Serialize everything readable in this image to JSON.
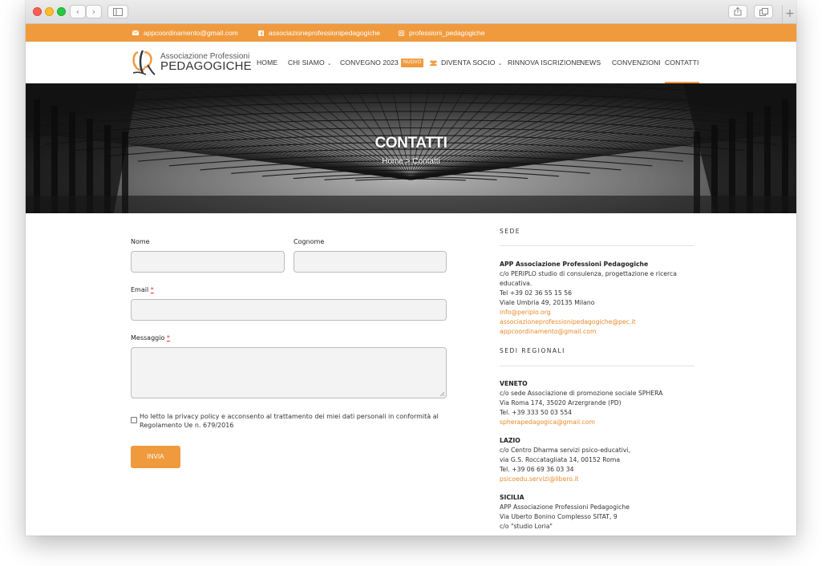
{
  "browser": {
    "back": "‹",
    "forward": "›",
    "new_tab": "+"
  },
  "topbar": {
    "email": "appcoordinamento@gmail.com",
    "facebook": "associazioneprofessionipedagogiche",
    "instagram": "professioni_pedagogiche"
  },
  "logo": {
    "line1": "Associazione Professioni",
    "line2": "PEDAGOGICHE"
  },
  "nav": {
    "home": "HOME",
    "chi_siamo": "CHI SIAMO",
    "convegno": "CONVEGNO 2023",
    "convegno_badge": "NUOVO",
    "diventa_socio": "DIVENTA SOCIO",
    "rinnova": "RINNOVA ISCRIZIONE",
    "news": "NEWS",
    "convenzioni": "CONVENZIONI",
    "contatti": "CONTATTI"
  },
  "hero": {
    "title": "CONTATTI",
    "breadcrumb": "Home > Contatti"
  },
  "form": {
    "nome_label": "Nome",
    "cognome_label": "Cognome",
    "email_label": "Email",
    "messaggio_label": "Messaggio",
    "required_mark": "*",
    "privacy_text": "Ho letto la privacy policy e acconsento al trattamento dei miei dati personali in conformità al Regolamento Ue n. 679/2016",
    "submit_label": "INVIA"
  },
  "sidebar": {
    "sede_heading": "SEDE",
    "sede": {
      "name": "APP Associazione Professioni Pedagogiche",
      "line1": "c/o PERIPLO studio di consulenza, progettazione e ricerca",
      "line2": "educativa.",
      "tel": "Tel +39 02 36 55 15 56",
      "address": "Viale Umbria 49, 20135 Milano",
      "email1": "info@periplo.org",
      "email2": "associazioneprofessionipedagogiche@pec.it",
      "email3": "appcoordinamento@gmail.com"
    },
    "regionali_heading": "SEDI REGIONALI",
    "veneto": {
      "name": "VENETO",
      "line1": "c/o sede Associazione di promozione sociale SPHERA",
      "line2": "Via Roma 174, 35020 Arzergrande (PD)",
      "tel": "Tel. +39 333 50 03 554",
      "email": "spherapedagogica@gmail.com"
    },
    "lazio": {
      "name": "LAZIO",
      "line1": "c/o Centro Dharma servizi psico-educativi,",
      "line2": "via G.S. Roccatagliata 14, 00152 Roma",
      "tel": "Tel. +39 06 69 36 03 34",
      "email": "psicoedu.servizi@libero.it"
    },
    "sicilia": {
      "name": "SICILIA",
      "line1": "APP Associazione Professioni Pedagogiche",
      "line2": "Via Uberto Bonino Complesso SITAT, 9",
      "line3": "c/o \"studio Loria\""
    }
  },
  "colors": {
    "accent": "#f09a3e",
    "link": "#e88a2a"
  }
}
